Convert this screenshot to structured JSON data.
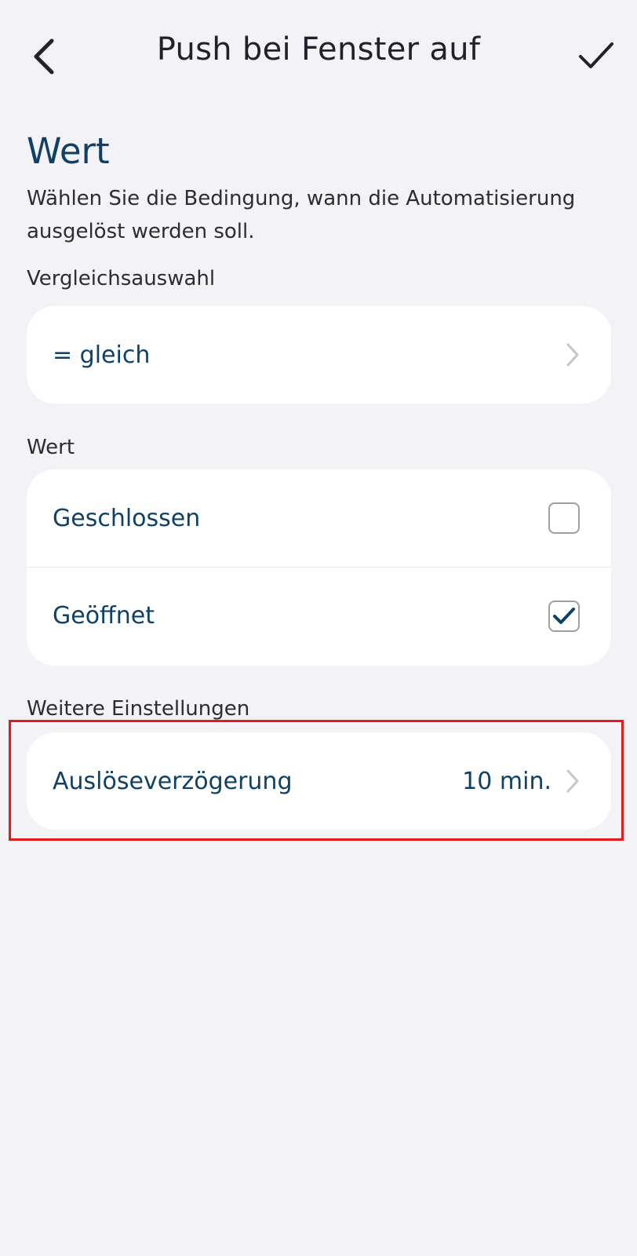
{
  "header": {
    "title": "Push bei Fenster auf",
    "back_icon": "chevron-left-icon",
    "confirm_icon": "checkmark-icon"
  },
  "section": {
    "title": "Wert",
    "description": "Wählen Sie die Bedingung, wann die Automatisierung ausgelöst werden soll."
  },
  "comparison": {
    "label": "Vergleichsauswahl",
    "selected": "= gleich"
  },
  "value_group": {
    "label": "Wert",
    "options": [
      {
        "label": "Geschlossen",
        "checked": false
      },
      {
        "label": "Geöffnet",
        "checked": true
      }
    ]
  },
  "settings": {
    "label": "Weitere Einstellungen",
    "delay_label": "Auslöseverzögerung",
    "delay_value": "10 min."
  },
  "colors": {
    "accent": "#0f4166",
    "background": "#f2f2f7",
    "highlight": "#e31b1b"
  }
}
